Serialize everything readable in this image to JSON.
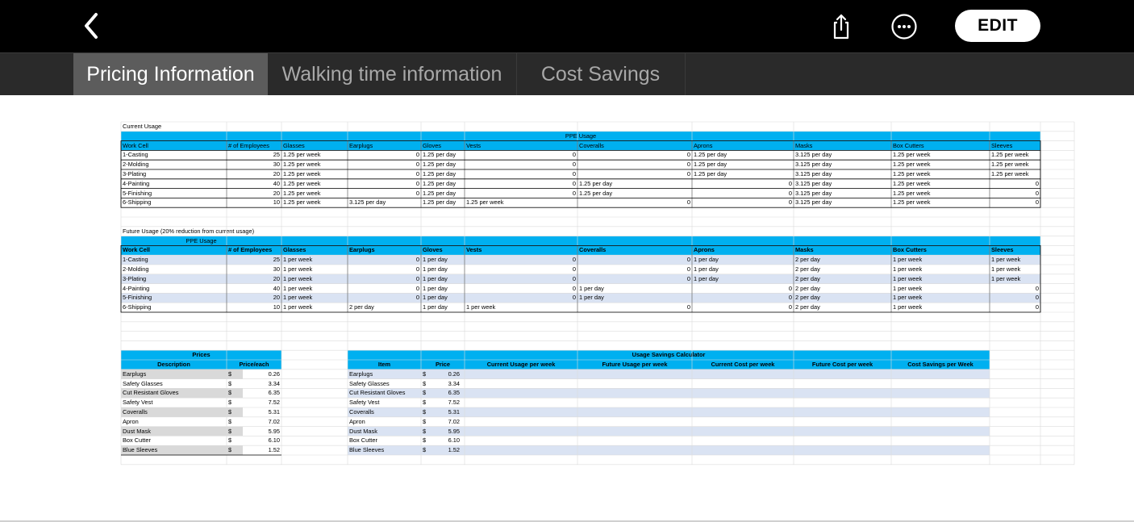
{
  "toolbar": {
    "back_icon": "chevron-left-icon",
    "share_icon": "share-icon",
    "more_icon": "ellipsis-circle-icon",
    "edit_label": "EDIT"
  },
  "tabs": [
    {
      "label": "Pricing Information",
      "active": true
    },
    {
      "label": "Walking time information",
      "active": false
    },
    {
      "label": "Cost Savings",
      "active": false
    }
  ],
  "sheet": {
    "current_title": "Current Usage",
    "ppe_usage": "PPE Usage",
    "headers": [
      "Work Cell",
      "# of Employees",
      "Glasses",
      "Earplugs",
      "Gloves",
      "Vests",
      "Coveralls",
      "Aprons",
      "Masks",
      "Box Cutters",
      "Sleeves"
    ],
    "current_rows": [
      [
        "1-Casting",
        "25",
        "1.25 per week",
        "0",
        "1.25 per day",
        "0",
        "0",
        "1.25 per day",
        "3.125 per day",
        "1.25 per week",
        "1.25 per week"
      ],
      [
        "2-Molding",
        "30",
        "1.25 per week",
        "0",
        "1.25 per day",
        "0",
        "0",
        "1.25 per day",
        "3.125 per day",
        "1.25 per week",
        "1.25 per week"
      ],
      [
        "3-Plating",
        "20",
        "1.25 per week",
        "0",
        "1.25 per day",
        "0",
        "0",
        "1.25 per day",
        "3.125 per day",
        "1.25 per week",
        "1.25 per week"
      ],
      [
        "4-Painting",
        "40",
        "1.25 per week",
        "0",
        "1.25 per day",
        "0",
        "1.25 per day",
        "0",
        "3.125 per day",
        "1.25 per week",
        "0"
      ],
      [
        "5-Finishing",
        "20",
        "1.25 per week",
        "0",
        "1.25 per day",
        "0",
        "1.25 per day",
        "0",
        "3.125 per day",
        "1.25 per week",
        "0"
      ],
      [
        "6-Shipping",
        "10",
        "1.25 per week",
        "3.125 per day",
        "1.25 per day",
        "1.25 per week",
        "0",
        "0",
        "3.125 per day",
        "1.25 per week",
        "0"
      ]
    ],
    "future_title": "Future Usage (20% reduction from current usage)",
    "future_rows": [
      [
        "1-Casting",
        "25",
        "1 per week",
        "0",
        "1 per day",
        "0",
        "0",
        "1 per day",
        "2 per day",
        "1 per week",
        "1 per week"
      ],
      [
        "2-Molding",
        "30",
        "1 per week",
        "0",
        "1 per day",
        "0",
        "0",
        "1 per day",
        "2 per day",
        "1 per week",
        "1 per week"
      ],
      [
        "3-Plating",
        "20",
        "1 per week",
        "0",
        "1 per day",
        "0",
        "0",
        "1 per day",
        "2 per day",
        "1 per week",
        "1 per week"
      ],
      [
        "4-Painting",
        "40",
        "1 per week",
        "0",
        "1 per day",
        "0",
        "1 per day",
        "0",
        "2 per day",
        "1 per week",
        "0"
      ],
      [
        "5-Finishing",
        "20",
        "1 per week",
        "0",
        "1 per day",
        "0",
        "1 per day",
        "0",
        "2 per day",
        "1 per week",
        "0"
      ],
      [
        "6-Shipping",
        "10",
        "1 per week",
        "2 per day",
        "1 per day",
        "1 per week",
        "0",
        "0",
        "2 per day",
        "1 per week",
        "0"
      ]
    ],
    "prices": {
      "title": "Prices",
      "headers": [
        "Description",
        "Price/each"
      ],
      "currency": "$",
      "rows": [
        [
          "Earplugs",
          "0.26"
        ],
        [
          "Safety Glasses",
          "3.34"
        ],
        [
          "Cut Resistant Gloves",
          "6.35"
        ],
        [
          "Safety Vest",
          "7.52"
        ],
        [
          "Coveralls",
          "5.31"
        ],
        [
          "Apron",
          "7.02"
        ],
        [
          "Dust Mask",
          "5.95"
        ],
        [
          "Box Cutter",
          "6.10"
        ],
        [
          "Blue Sleeves",
          "1.52"
        ]
      ]
    },
    "calculator": {
      "title": "Usage Savings Calculator",
      "headers": [
        "Item",
        "Price",
        "Current Usage per week",
        "Future Usage per week",
        "Current Cost per week",
        "Future Cost per week",
        "Cost Savings per Week"
      ]
    }
  },
  "colors": {
    "header_blue": "#00b0f0",
    "dark_blue": "#1f4e79",
    "band_light": "#dae3f3",
    "band_gray": "#d9d9d9"
  }
}
